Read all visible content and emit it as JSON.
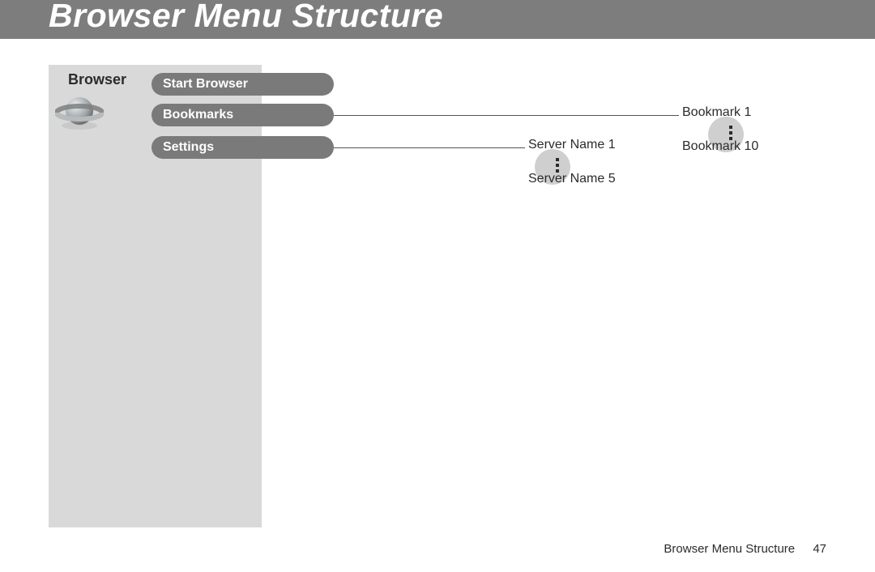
{
  "header": {
    "title": "Browser Menu Structure"
  },
  "section": {
    "label": "Browser",
    "icon": "globe-icon"
  },
  "menu": {
    "items": [
      {
        "label": "Start Browser"
      },
      {
        "label": "Bookmarks"
      },
      {
        "label": "Settings"
      }
    ]
  },
  "settings_children": {
    "first": "Server Name 1",
    "last": "Server Name 5"
  },
  "bookmarks_children": {
    "first": "Bookmark 1",
    "last": "Bookmark 10"
  },
  "footer": {
    "text": "Browser Menu Structure",
    "page": "47"
  }
}
